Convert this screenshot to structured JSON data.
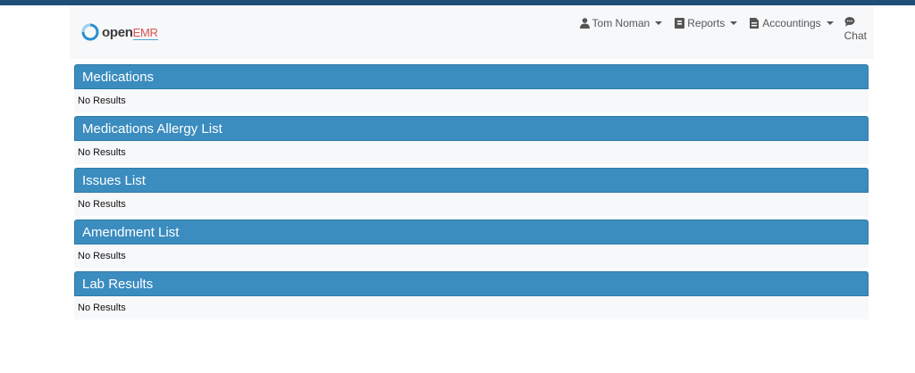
{
  "brand": {
    "name_open": "open",
    "name_emr": "EMR"
  },
  "nav": {
    "user": "Tom Noman",
    "reports": "Reports",
    "accountings": "Accountings",
    "chat": "Chat"
  },
  "colors": {
    "topbar": "#1f4e79",
    "panel_header": "#3b8cbf",
    "panel_body": "#f7f8fa"
  },
  "panels": [
    {
      "title": "Medications",
      "body": "No Results"
    },
    {
      "title": "Medications Allergy List",
      "body": "No Results"
    },
    {
      "title": "Issues List",
      "body": "No Results"
    },
    {
      "title": "Amendment List",
      "body": "No Results"
    },
    {
      "title": "Lab Results",
      "body": "No Results"
    }
  ]
}
